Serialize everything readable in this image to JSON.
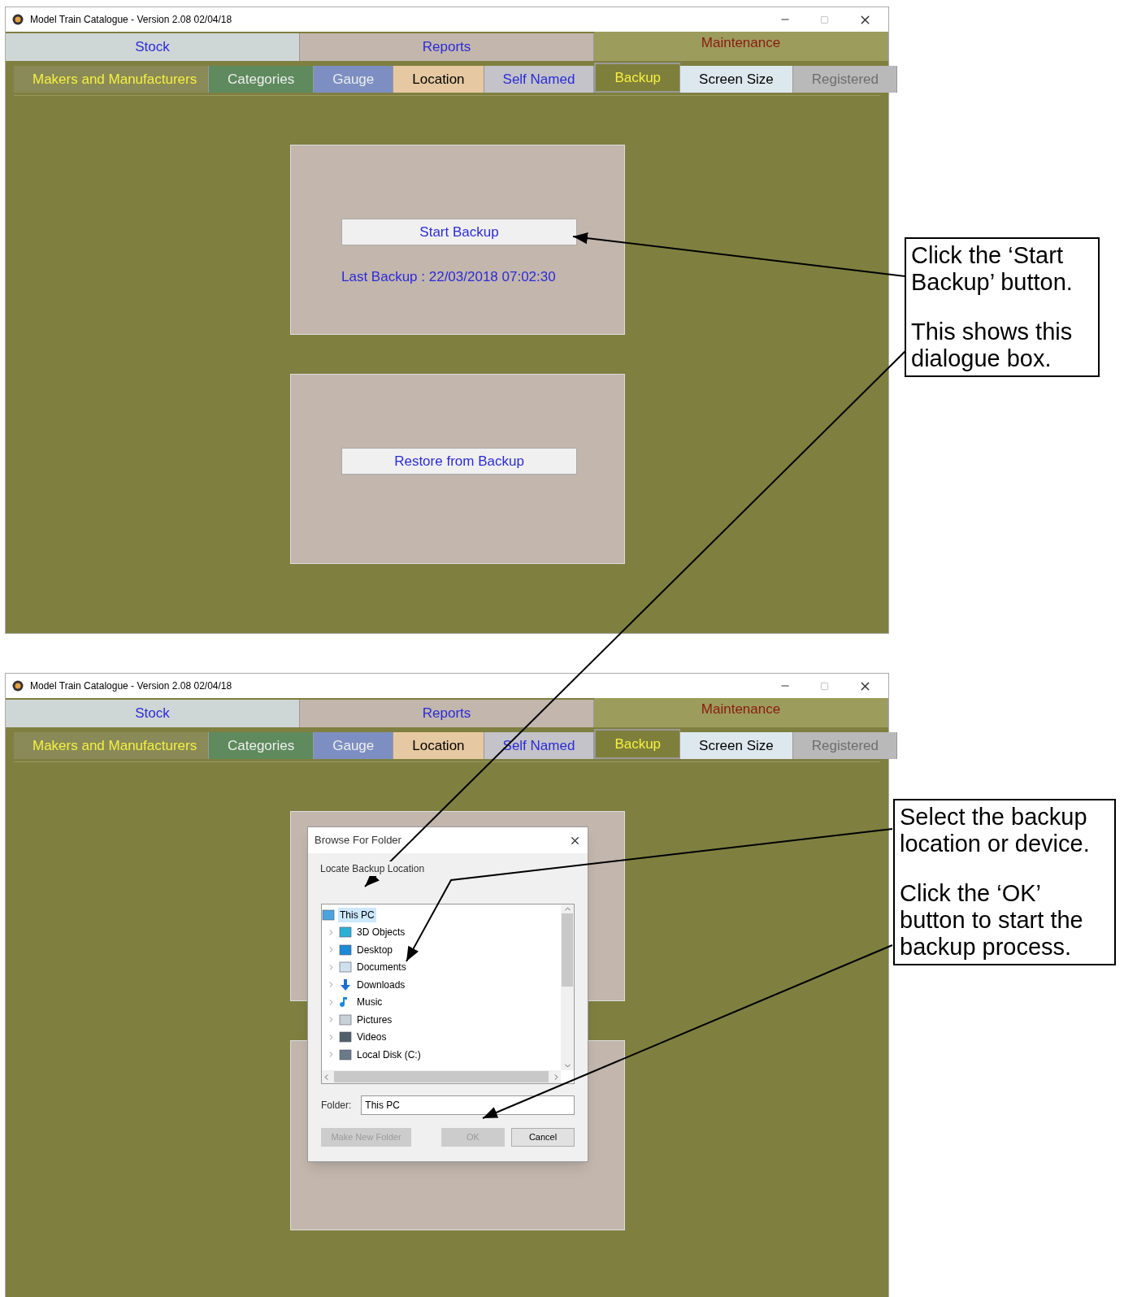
{
  "windows": [
    {
      "title": "Model Train Catalogue -  Version 2.08  02/04/18",
      "main_tabs": [
        {
          "label": "Stock",
          "selected": false
        },
        {
          "label": "Reports",
          "selected": false
        },
        {
          "label": "Maintenance",
          "selected": true
        }
      ],
      "sub_tabs": [
        {
          "label": "Makers and Manufacturers",
          "selected": false,
          "disabled": false,
          "color": "#8a8a58"
        },
        {
          "label": "Categories",
          "selected": false,
          "disabled": false,
          "color": "#5e8a5e"
        },
        {
          "label": "Gauge",
          "selected": false,
          "disabled": false,
          "color": "#7d8fc2"
        },
        {
          "label": "Location",
          "selected": false,
          "disabled": false,
          "color": "#e6c9a2"
        },
        {
          "label": "Self Named",
          "selected": false,
          "disabled": false,
          "color": "#c3c3c9"
        },
        {
          "label": "Backup",
          "selected": true,
          "disabled": false,
          "color": "#7f7f3c"
        },
        {
          "label": "Screen Size",
          "selected": false,
          "disabled": false,
          "color": "#dde8ee"
        },
        {
          "label": "Registered",
          "selected": false,
          "disabled": true,
          "color": "#b9b9b9"
        }
      ],
      "panels": [
        {
          "button": "Start Backup",
          "note": "Last Backup : 22/03/2018 07:02:30"
        },
        {
          "button": "Restore from Backup"
        }
      ]
    },
    {
      "title": "Model Train Catalogue -  Version 2.08  02/04/18",
      "main_tabs": [
        {
          "label": "Stock",
          "selected": false
        },
        {
          "label": "Reports",
          "selected": false
        },
        {
          "label": "Maintenance",
          "selected": true
        }
      ],
      "sub_tabs": [
        {
          "label": "Makers and Manufacturers",
          "selected": false,
          "disabled": false,
          "color": "#8a8a58"
        },
        {
          "label": "Categories",
          "selected": false,
          "disabled": false,
          "color": "#5e8a5e"
        },
        {
          "label": "Gauge",
          "selected": false,
          "disabled": false,
          "color": "#7d8fc2"
        },
        {
          "label": "Location",
          "selected": false,
          "disabled": false,
          "color": "#e6c9a2"
        },
        {
          "label": "Self Named",
          "selected": false,
          "disabled": false,
          "color": "#c3c3c9"
        },
        {
          "label": "Backup",
          "selected": true,
          "disabled": false,
          "color": "#7f7f3c"
        },
        {
          "label": "Screen Size",
          "selected": false,
          "disabled": false,
          "color": "#dde8ee"
        },
        {
          "label": "Registered",
          "selected": false,
          "disabled": true,
          "color": "#b9b9b9"
        }
      ],
      "dialog": {
        "title": "Browse For Folder",
        "instruction": "Locate Backup Location",
        "tree": [
          {
            "label": "This PC",
            "kind": "pc",
            "selected": true,
            "children": [
              {
                "label": "3D Objects",
                "kind": "cube",
                "selected": false
              },
              {
                "label": "Desktop",
                "kind": "desktop",
                "selected": false
              },
              {
                "label": "Documents",
                "kind": "document",
                "selected": false
              },
              {
                "label": "Downloads",
                "kind": "download",
                "selected": false
              },
              {
                "label": "Music",
                "kind": "music",
                "selected": false
              },
              {
                "label": "Pictures",
                "kind": "pictures",
                "selected": false
              },
              {
                "label": "Videos",
                "kind": "videos",
                "selected": false
              },
              {
                "label": "Local Disk (C:)",
                "kind": "disk",
                "selected": false
              }
            ]
          }
        ],
        "folder_label": "Folder:",
        "folder_value": "This PC",
        "buttons": [
          {
            "label": "Make New Folder",
            "disabled": true
          },
          {
            "label": "OK",
            "disabled": true
          },
          {
            "label": "Cancel",
            "disabled": false
          }
        ]
      }
    }
  ],
  "callouts": [
    {
      "paragraphs": [
        "Click the ‘Start Backup’ button.",
        "This shows this dialogue box."
      ]
    },
    {
      "paragraphs": [
        "Select the backup location or device.",
        "Click the ‘OK’ button to start the backup process."
      ]
    }
  ]
}
